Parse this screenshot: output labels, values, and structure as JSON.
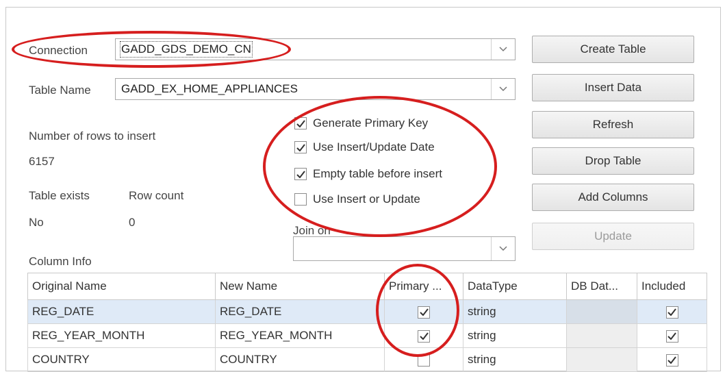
{
  "form": {
    "connection_label": "Connection",
    "connection_value": "GADD_GDS_DEMO_CN",
    "table_name_label": "Table Name",
    "table_name_value": "GADD_EX_HOME_APPLIANCES",
    "rows_label": "Number of rows to insert",
    "rows_value": "6157",
    "table_exists_label": "Table exists",
    "table_exists_value": "No",
    "row_count_label": "Row count",
    "row_count_value": "0",
    "join_on_label": "Join on",
    "join_on_value": "",
    "column_info_label": "Column Info"
  },
  "options": [
    {
      "label": "Generate Primary Key",
      "checked": true
    },
    {
      "label": "Use Insert/Update Date",
      "checked": true
    },
    {
      "label": "Empty table before insert",
      "checked": true
    },
    {
      "label": "Use Insert or Update",
      "checked": false
    }
  ],
  "buttons": {
    "create_table": "Create Table",
    "insert_data": "Insert Data",
    "refresh": "Refresh",
    "drop_table": "Drop Table",
    "add_columns": "Add Columns",
    "update": "Update"
  },
  "grid": {
    "headers": [
      "Original Name",
      "New Name",
      "Primary ...",
      "DataType",
      "DB Dat...",
      "Included"
    ],
    "rows": [
      {
        "original": "REG_DATE",
        "new": "REG_DATE",
        "primary": true,
        "datatype": "string",
        "db": "",
        "included": true
      },
      {
        "original": "REG_YEAR_MONTH",
        "new": "REG_YEAR_MONTH",
        "primary": true,
        "datatype": "string",
        "db": "",
        "included": true
      },
      {
        "original": "COUNTRY",
        "new": "COUNTRY",
        "primary": false,
        "datatype": "string",
        "db": "",
        "included": true
      }
    ]
  },
  "colors": {
    "highlight": "#d61e1e",
    "selected_row": "#dfeaf7"
  }
}
